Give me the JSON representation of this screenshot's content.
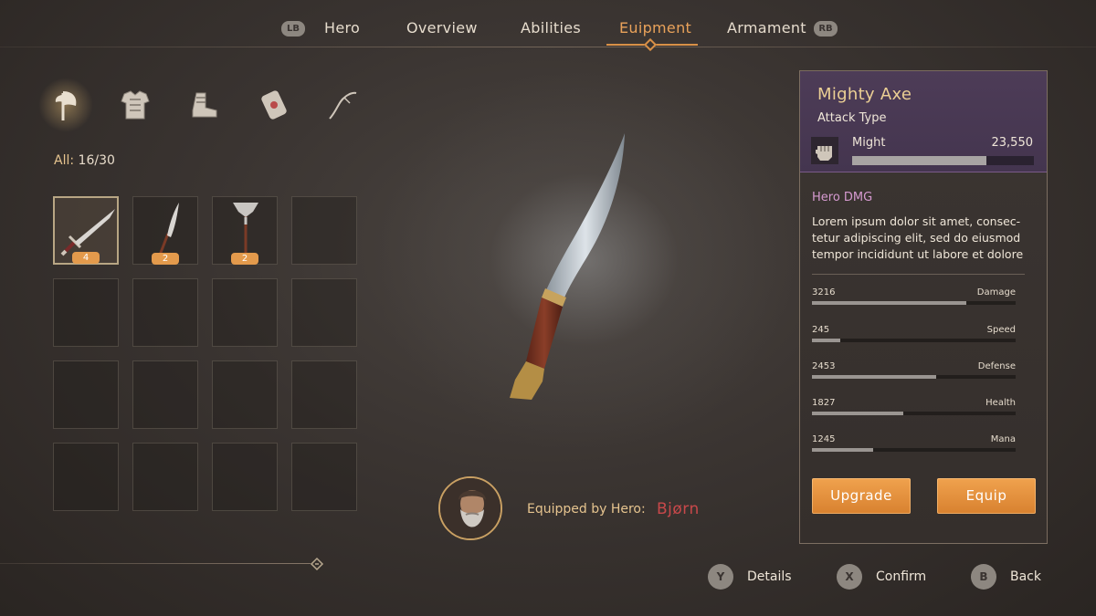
{
  "nav": {
    "lb": "LB",
    "rb": "RB",
    "tabs": [
      {
        "label": "Hero"
      },
      {
        "label": "Overview"
      },
      {
        "label": "Abilities"
      },
      {
        "label": "Euipment",
        "active": true
      },
      {
        "label": "Armament"
      }
    ]
  },
  "categories": [
    {
      "icon": "axe-icon",
      "active": true
    },
    {
      "icon": "armor-icon"
    },
    {
      "icon": "boot-icon"
    },
    {
      "icon": "shield-icon"
    },
    {
      "icon": "bow-icon"
    }
  ],
  "inventory": {
    "count_label": "All:",
    "count_value": "16/30",
    "items": [
      {
        "icon": "sword-icon",
        "count": "4",
        "selected": true
      },
      {
        "icon": "blade-icon",
        "count": "2"
      },
      {
        "icon": "poleaxe-icon",
        "count": "2"
      }
    ],
    "total_slots": 16
  },
  "hero": {
    "equipped_label": "Equipped by Hero:",
    "name": "Bjørn"
  },
  "weapon": {
    "name": "Mighty Axe",
    "type": "Attack Type",
    "might_label": "Might",
    "might_value": "23,550",
    "might_fraction": 0.74,
    "dmg_title": "Hero DMG",
    "description": "Lorem ipsum dolor sit amet, consec-tetur adipiscing elit, sed do eiusmod tempor incididunt ut labore et dolore",
    "stats": [
      {
        "value": "3216",
        "name": "Damage",
        "fraction": 0.76
      },
      {
        "value": "245",
        "name": "Speed",
        "fraction": 0.14
      },
      {
        "value": "2453",
        "name": "Defense",
        "fraction": 0.61
      },
      {
        "value": "1827",
        "name": "Health",
        "fraction": 0.45
      },
      {
        "value": "1245",
        "name": "Mana",
        "fraction": 0.3
      }
    ],
    "upgrade_label": "Upgrade",
    "equip_label": "Equip"
  },
  "footer": [
    {
      "button": "Y",
      "label": "Details"
    },
    {
      "button": "X",
      "label": "Confirm"
    },
    {
      "button": "B",
      "label": "Back"
    }
  ],
  "colors": {
    "accent": "#e39a4c",
    "active_tab": "#e9a25a",
    "hero_name": "#c8484a",
    "panel_header": "#4d3c57"
  }
}
